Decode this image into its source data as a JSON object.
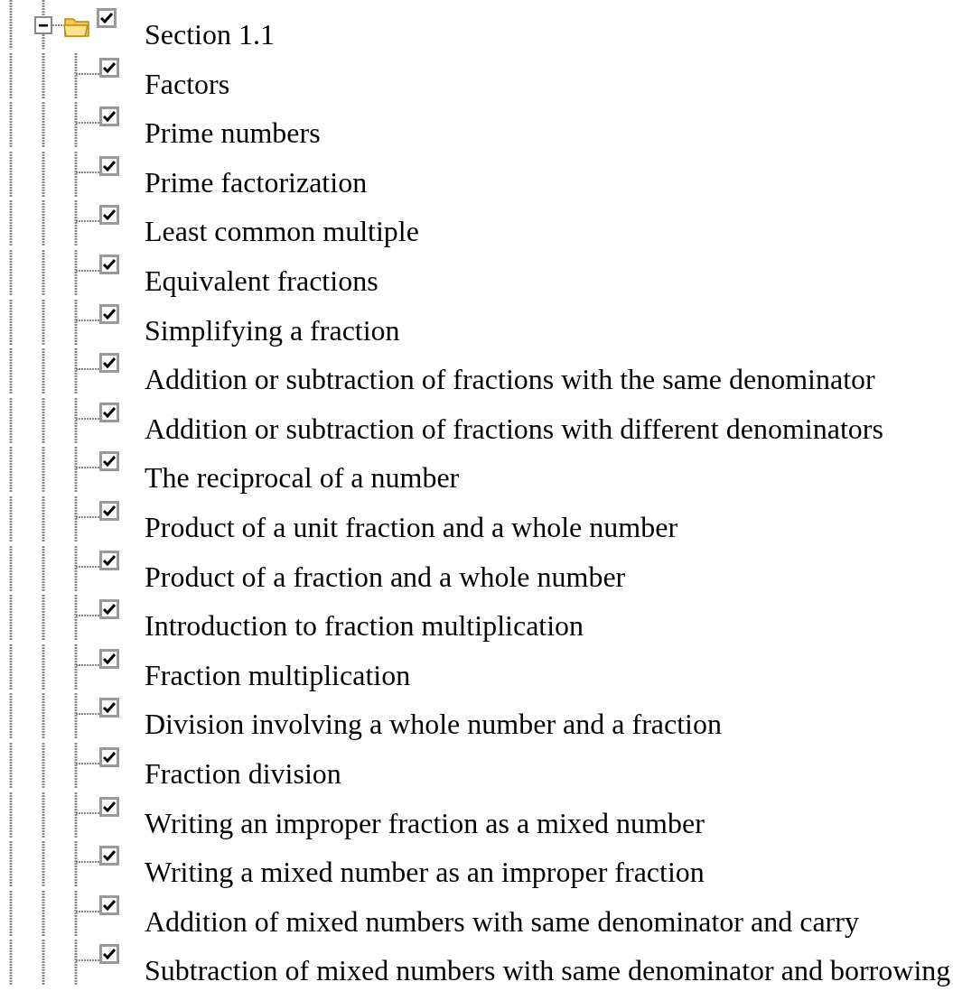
{
  "tree": {
    "label": "Section 1.1",
    "expanded": true,
    "checked": true,
    "children": [
      {
        "label": "Factors",
        "checked": true
      },
      {
        "label": "Prime numbers",
        "checked": true
      },
      {
        "label": "Prime factorization",
        "checked": true
      },
      {
        "label": "Least common multiple",
        "checked": true
      },
      {
        "label": "Equivalent fractions",
        "checked": true
      },
      {
        "label": "Simplifying a fraction",
        "checked": true
      },
      {
        "label": "Addition or subtraction of fractions with the same denominator",
        "checked": true
      },
      {
        "label": "Addition or subtraction of fractions with different denominators",
        "checked": true
      },
      {
        "label": "The reciprocal of a number",
        "checked": true
      },
      {
        "label": "Product of a unit fraction and a whole number",
        "checked": true
      },
      {
        "label": "Product of a fraction and a whole number",
        "checked": true
      },
      {
        "label": "Introduction to fraction multiplication",
        "checked": true
      },
      {
        "label": "Fraction multiplication",
        "checked": true
      },
      {
        "label": "Division involving a whole number and a fraction",
        "checked": true
      },
      {
        "label": "Fraction division",
        "checked": true
      },
      {
        "label": "Writing an improper fraction as a mixed number",
        "checked": true
      },
      {
        "label": "Writing a mixed number as an improper fraction",
        "checked": true
      },
      {
        "label": "Addition of mixed numbers with same denominator and carry",
        "checked": true
      },
      {
        "label": "Subtraction of mixed numbers with same denominator and borrowing",
        "checked": true
      }
    ]
  }
}
